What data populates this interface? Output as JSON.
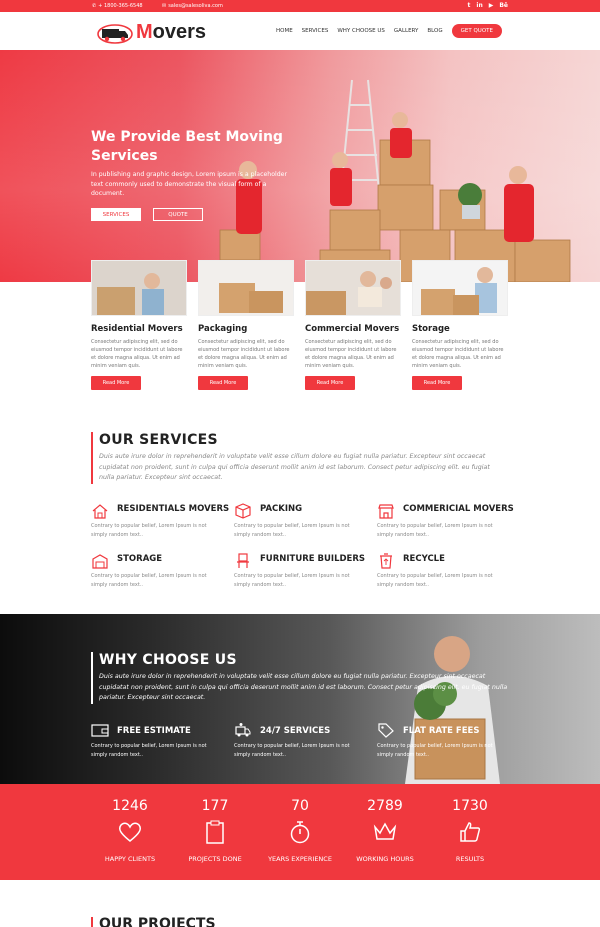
{
  "topbar": {
    "phone": "+ 1800-365-6548",
    "email": "sales@salesoliva.com",
    "social": [
      "t",
      "in",
      "yt",
      "be"
    ]
  },
  "brand": {
    "name_first": "M",
    "name_rest": "overs"
  },
  "nav": {
    "items": [
      "HOME",
      "SERVICES",
      "WHY CHOOSE US",
      "GALLERY",
      "BLOG"
    ],
    "cta": "GET QUOTE"
  },
  "hero": {
    "title": "We Provide Best Moving Services",
    "text": "In publishing and graphic design, Lorem ipsum is a placeholder text commonly used to demonstrate the visual form of a document.",
    "btn_services": "SERVICES",
    "btn_quote": "QUOTE"
  },
  "cards": [
    {
      "name": "Residential Movers",
      "desc": "Consectetur adipiscing elit, sed do eiusmod tempor incididunt ut labore et dolore magna aliqua. Ut enim ad minim veniam quis.",
      "btn": "Read More"
    },
    {
      "name": "Packaging",
      "desc": "Consectetur adipiscing elit, sed do eiusmod tempor incididunt ut labore et dolore magna aliqua. Ut enim ad minim veniam quis.",
      "btn": "Read More"
    },
    {
      "name": "Commercial Movers",
      "desc": "Consectetur adipiscing elit, sed do eiusmod tempor incididunt ut labore et dolore magna aliqua. Ut enim ad minim veniam quis.",
      "btn": "Read More"
    },
    {
      "name": "Storage",
      "desc": "Consectetur adipiscing elit, sed do eiusmod tempor incididunt ut labore et dolore magna aliqua. Ut enim ad minim veniam quis.",
      "btn": "Read More"
    }
  ],
  "services": {
    "title": "OUR SERVICES",
    "text": "Duis aute irure dolor in reprehenderit in voluptate velit esse cillum dolore eu fugiat nulla pariatur. Excepteur sint occaecat cupidatat non proident, sunt in culpa qui officia deserunt mollit anim id est laborum. Consect petur adipiscing elit. eu fugiat nulla pariatur. Excepteur sint occaecat.",
    "items": [
      {
        "title": "RESIDENTIALS MOVERS",
        "desc": "Contrary to popular belief, Lorem Ipsum is not simply random text..",
        "icon": "house-icon"
      },
      {
        "title": "PACKING",
        "desc": "Contrary to popular belief, Lorem Ipsum is not simply random text..",
        "icon": "package-icon"
      },
      {
        "title": "COMMERICIAL MOVERS",
        "desc": "Contrary to popular belief, Lorem Ipsum is not simply random text..",
        "icon": "storefront-icon"
      },
      {
        "title": "STORAGE",
        "desc": "Contrary to popular belief, Lorem Ipsum is not simply random text..",
        "icon": "warehouse-icon"
      },
      {
        "title": "FURNITURE BUILDERS",
        "desc": "Contrary to popular belief, Lorem Ipsum is not simply random text..",
        "icon": "chair-icon"
      },
      {
        "title": "RECYCLE",
        "desc": "Contrary to popular belief, Lorem Ipsum is not simply random text..",
        "icon": "recycle-icon"
      }
    ]
  },
  "why": {
    "title": "WHY CHOOSE US",
    "text": "Duis aute irure dolor in reprehenderit in voluptate velit esse cillum dolore eu fugiat nulla pariatur. Excepteur sint occaecat cupidatat non proident, sunt in culpa qui officia deserunt mollit anim id est laborum. Consect petur adipiscing elit. eu fugiat nulla pariatur. Excepteur sint occaecat.",
    "items": [
      {
        "title": "FREE ESTIMATE",
        "desc": "Contrary to popular belief, Lorem Ipsum is not simply random text..",
        "icon": "wallet-icon"
      },
      {
        "title": "24/7 SERVICES",
        "desc": "Contrary to popular belief, Lorem Ipsum is not simply random text..",
        "icon": "delivery-icon"
      },
      {
        "title": "FLAT RATE FEES",
        "desc": "Contrary to popular belief, Lorem Ipsum is not simply random text..",
        "icon": "tag-icon"
      }
    ]
  },
  "stats": [
    {
      "num": "1246",
      "label": "HAPPY CLIENTS",
      "icon": "heart-icon"
    },
    {
      "num": "177",
      "label": "PROJECTS DONE",
      "icon": "clipboard-icon"
    },
    {
      "num": "70",
      "label": "YEARS EXPERIENCE",
      "icon": "stopwatch-icon"
    },
    {
      "num": "2789",
      "label": "WORKING HOURS",
      "icon": "crown-icon"
    },
    {
      "num": "1730",
      "label": "RESULTS",
      "icon": "thumbs-up-icon"
    }
  ],
  "projects": {
    "title": "OUR PROJECTS"
  },
  "colors": {
    "accent": "#f0383e",
    "dark": "#222222"
  }
}
